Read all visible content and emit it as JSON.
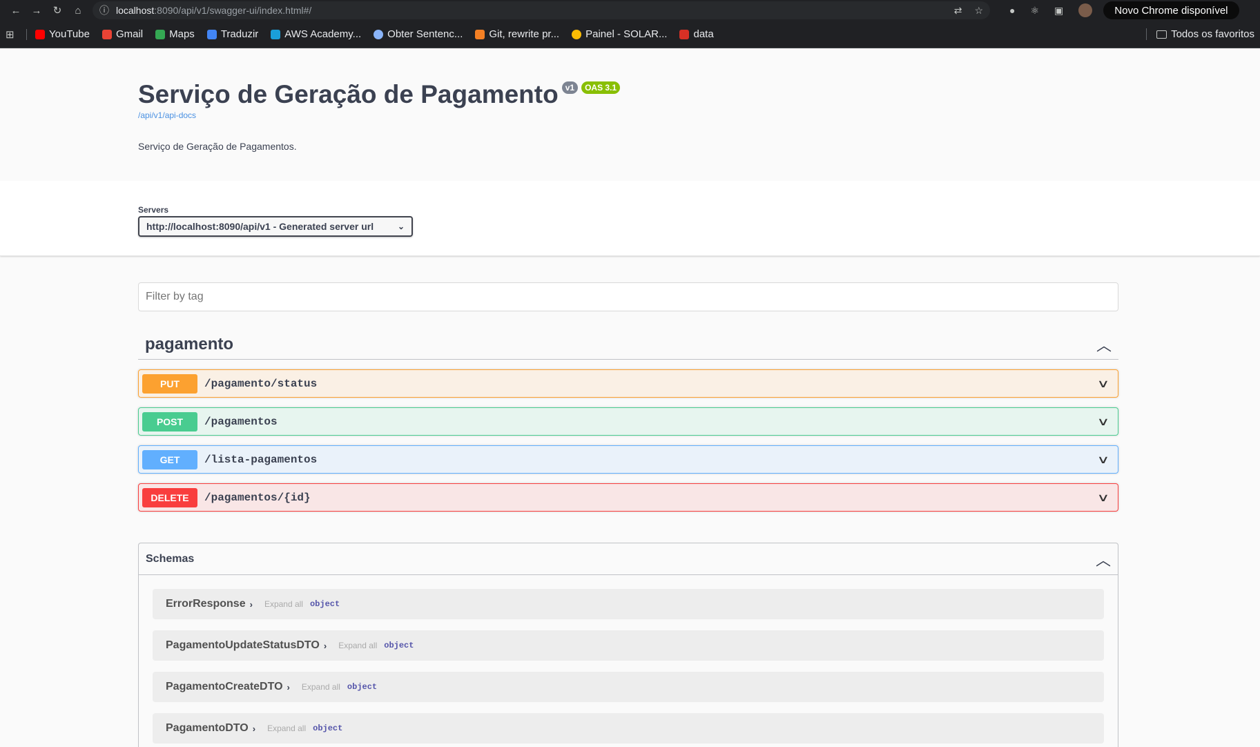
{
  "browser": {
    "url_host": "localhost",
    "url_path": ":8090/api/v1/swagger-ui/index.html#/",
    "update_label": "Novo Chrome disponível",
    "bookmarks": [
      {
        "label": "YouTube",
        "color": "#ff0000"
      },
      {
        "label": "Gmail",
        "color": "#ea4335"
      },
      {
        "label": "Maps",
        "color": "#34a853"
      },
      {
        "label": "Traduzir",
        "color": "#4285f4"
      },
      {
        "label": "AWS Academy...",
        "color": "#1a9fd9"
      },
      {
        "label": "Obter Sentenc...",
        "color": "#8ab4f8"
      },
      {
        "label": "Git, rewrite pr...",
        "color": "#f48024"
      },
      {
        "label": "Painel - SOLAR...",
        "color": "#fbbc04"
      },
      {
        "label": "data",
        "color": "#d93025"
      }
    ],
    "all_bookmarks_label": "Todos os favoritos"
  },
  "info": {
    "title": "Serviço de Geração de Pagamento",
    "version_badge": "v1",
    "oas_badge": "OAS 3.1",
    "api_docs_link": "/api/v1/api-docs",
    "description": "Serviço de Geração de Pagamentos."
  },
  "servers": {
    "label": "Servers",
    "selected": "http://localhost:8090/api/v1 - Generated server url"
  },
  "filter": {
    "placeholder": "Filter by tag"
  },
  "tag": {
    "name": "pagamento",
    "operations": [
      {
        "method": "PUT",
        "path": "/pagamento/status",
        "color": "#fca130"
      },
      {
        "method": "POST",
        "path": "/pagamentos",
        "color": "#49cc90"
      },
      {
        "method": "GET",
        "path": "/lista-pagamentos",
        "color": "#61affe"
      },
      {
        "method": "DELETE",
        "path": "/pagamentos/{id}",
        "color": "#f93e3e"
      }
    ]
  },
  "schemas": {
    "title": "Schemas",
    "items": [
      {
        "name": "ErrorResponse",
        "expand": "Expand all",
        "type": "object"
      },
      {
        "name": "PagamentoUpdateStatusDTO",
        "expand": "Expand all",
        "type": "object"
      },
      {
        "name": "PagamentoCreateDTO",
        "expand": "Expand all",
        "type": "object"
      },
      {
        "name": "PagamentoDTO",
        "expand": "Expand all",
        "type": "object"
      }
    ]
  }
}
